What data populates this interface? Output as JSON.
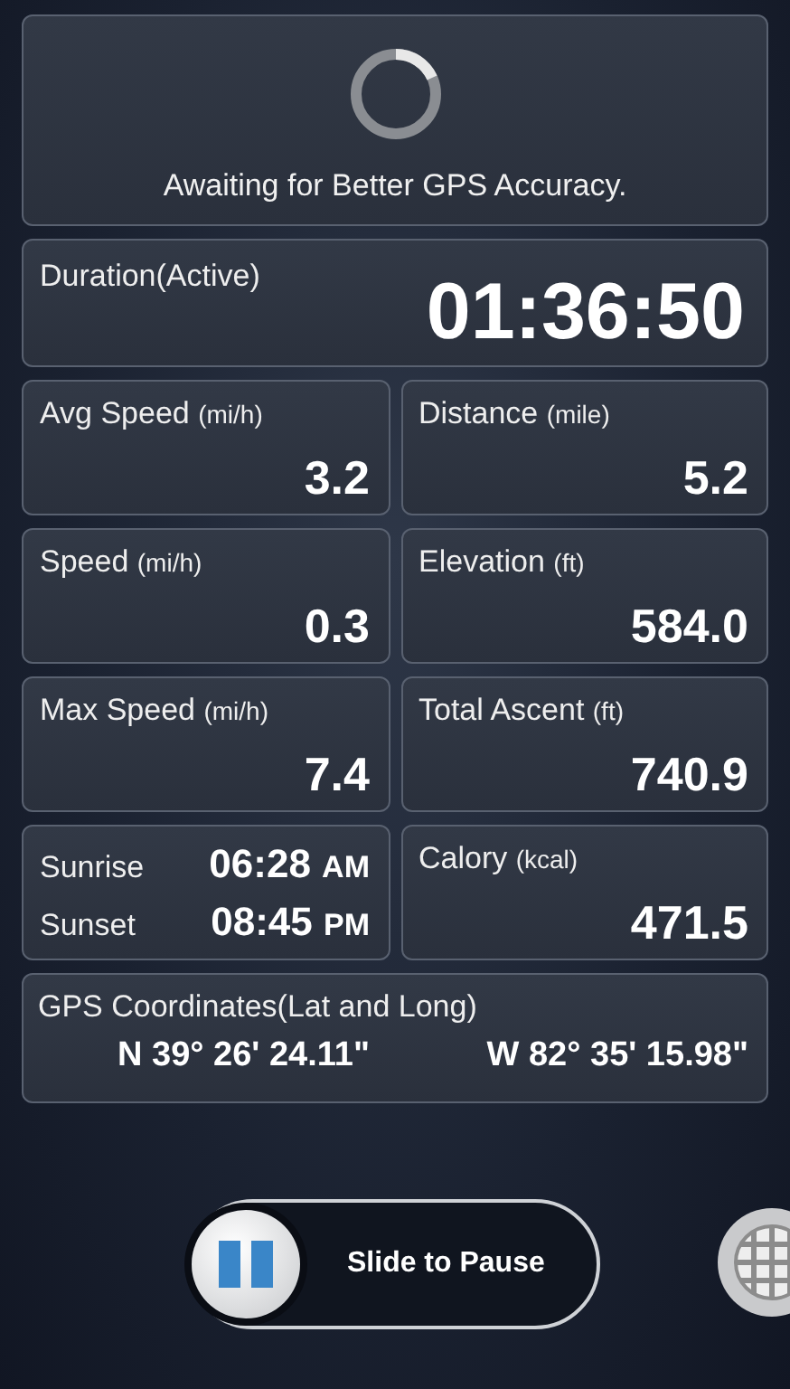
{
  "status": {
    "message": "Awaiting for Better GPS Accuracy."
  },
  "duration": {
    "label": "Duration(Active)",
    "value": "01:36:50"
  },
  "tiles": [
    {
      "kind": "metric",
      "label": "Avg Speed",
      "unit": "(mi/h)",
      "value": "3.2"
    },
    {
      "kind": "metric",
      "label": "Distance",
      "unit": "(mile)",
      "value": "5.2"
    },
    {
      "kind": "metric",
      "label": "Speed",
      "unit": "(mi/h)",
      "value": "0.3"
    },
    {
      "kind": "metric",
      "label": "Elevation",
      "unit": "(ft)",
      "value": "584.0"
    },
    {
      "kind": "metric",
      "label": "Max Speed",
      "unit": "(mi/h)",
      "value": "7.4"
    },
    {
      "kind": "metric",
      "label": "Total Ascent",
      "unit": "(ft)",
      "value": "740.9"
    },
    {
      "kind": "sun",
      "rows": [
        {
          "label": "Sunrise",
          "time": "06:28",
          "period": "AM"
        },
        {
          "label": "Sunset",
          "time": "08:45",
          "period": "PM"
        }
      ]
    },
    {
      "kind": "metric",
      "label": "Calory",
      "unit": "(kcal)",
      "value": "471.5"
    }
  ],
  "gps": {
    "label": "GPS Coordinates(Lat and Long)",
    "latitude": "N 39° 26' 24.11\"",
    "longitude": "W 82° 35' 15.98\""
  },
  "slider": {
    "label": "Slide to Pause",
    "level": 0
  }
}
